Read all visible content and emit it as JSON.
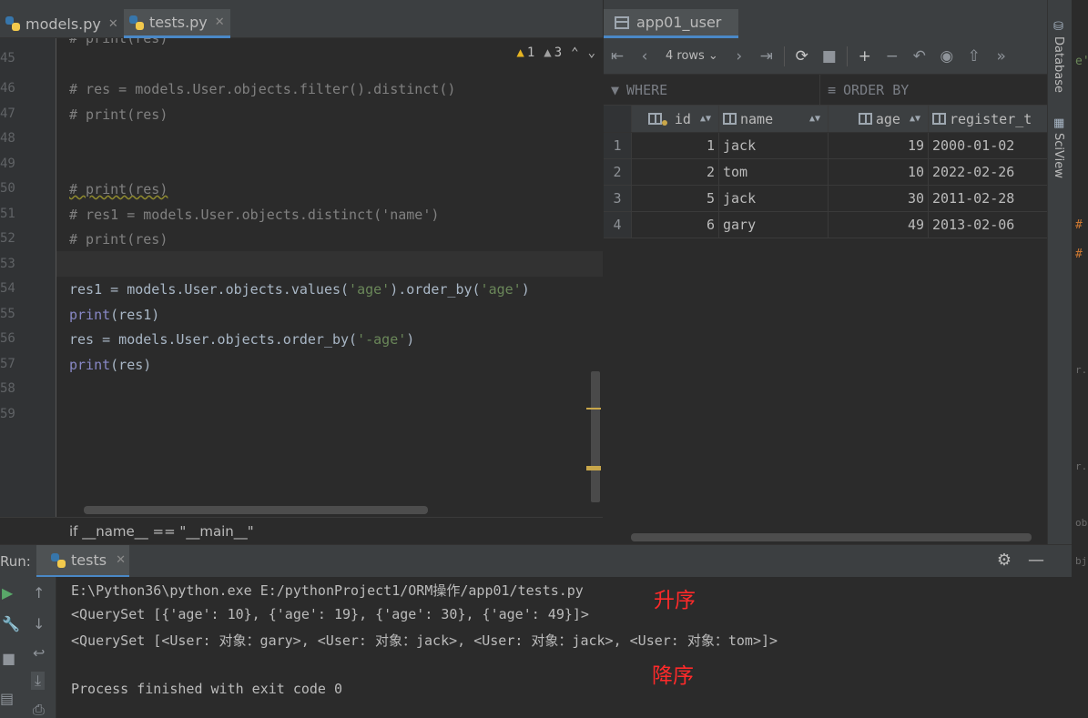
{
  "editor_tabs": [
    {
      "label": "models.py",
      "active": false
    },
    {
      "label": "tests.py",
      "active": true
    }
  ],
  "inspections": {
    "warnings": "1",
    "weak_warnings": "3"
  },
  "editor": {
    "line_numbers": [
      "45",
      "46",
      "47",
      "48",
      "49",
      "50",
      "51",
      "52",
      "53",
      "54",
      "55",
      "56",
      "57",
      "58",
      "59"
    ],
    "partial_top_line": "# print(res)",
    "lines": {
      "l46": "# res = models.User.objects.filter().distinct()",
      "l47": "# print(res)",
      "l50": "# print(res)",
      "l51": "# res1 = models.User.objects.distinct('name')",
      "l52": "# print(res)",
      "l54_a": "res1 = models.User.objects.values(",
      "l54_s1": "'age'",
      "l54_b": ").order_by(",
      "l54_s2": "'age'",
      "l54_c": ")",
      "l55_kw": "print",
      "l55_rest": "(res1)",
      "l56_a": "res = models.User.objects.order_by(",
      "l56_s": "'-age'",
      "l56_b": ")",
      "l57_kw": "print",
      "l57_rest": "(res)"
    },
    "breadcrumb": "if __name__ == \"__main__\""
  },
  "db_panel": {
    "tab_label": "app01_user",
    "rows_selector": "4 rows",
    "where_label": "WHERE",
    "order_by_label": "ORDER BY",
    "columns": [
      "id",
      "name",
      "age",
      "register_t"
    ],
    "rows": [
      {
        "rn": "1",
        "id": "1",
        "name": "jack",
        "age": "19",
        "register": "2000-01-02"
      },
      {
        "rn": "2",
        "id": "2",
        "name": "tom",
        "age": "10",
        "register": "2022-02-26"
      },
      {
        "rn": "3",
        "id": "5",
        "name": "jack",
        "age": "30",
        "register": "2011-02-28"
      },
      {
        "rn": "4",
        "id": "6",
        "name": "gary",
        "age": "49",
        "register": "2013-02-06"
      }
    ]
  },
  "right_strip": {
    "database": "Database",
    "sciview": "SciView"
  },
  "run": {
    "label": "Run:",
    "tab": "tests",
    "console": [
      "E:\\Python36\\python.exe E:/pythonProject1/ORM操作/app01/tests.py",
      "<QuerySet [{'age': 10}, {'age': 19}, {'age': 30}, {'age': 49}]>",
      "<QuerySet [<User: 对象：gary>, <User: 对象：jack>, <User: 对象：jack>, <User: 对象：tom>]>",
      "Process finished with exit code 0"
    ],
    "annotations": {
      "ascending": "升序",
      "descending": "降序"
    }
  }
}
